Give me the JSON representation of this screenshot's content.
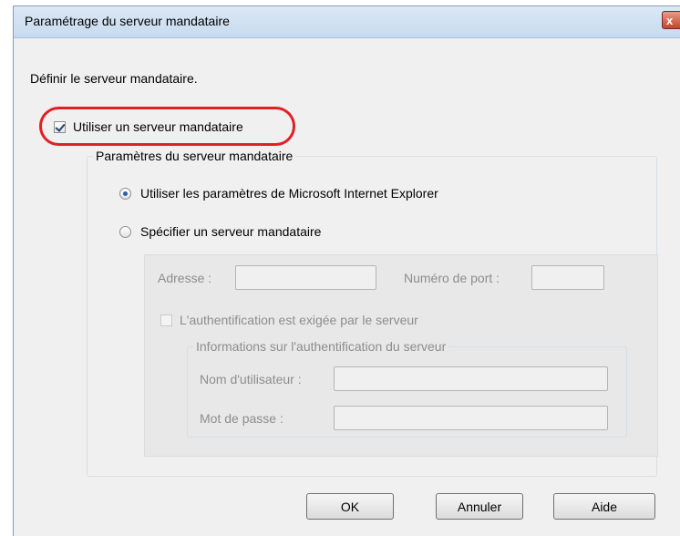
{
  "window": {
    "title": "Paramétrage du serveur mandataire",
    "close_glyph": "x"
  },
  "intro": "Définir le serveur mandataire.",
  "use_proxy": {
    "label": "Utiliser un serveur mandataire",
    "checked": true
  },
  "settings": {
    "legend": "Paramètres du serveur mandataire",
    "option_ie": "Utiliser les paramètres de Microsoft Internet Explorer",
    "option_specify": "Spécifier un serveur mandataire",
    "selected": "option_ie",
    "address_label": "Adresse :",
    "port_label": "Numéro de port :",
    "auth_required_label": "L'authentification est exigée par le serveur",
    "auth": {
      "legend": "Informations sur l'authentification du serveur",
      "username_label": "Nom d'utilisateur :",
      "password_label": "Mot de passe :"
    }
  },
  "buttons": {
    "ok": "OK",
    "cancel": "Annuler",
    "help": "Aide"
  },
  "colors": {
    "highlight": "#e31f26",
    "window_bg": "#f0f0f0"
  },
  "icons": {
    "close": "close-icon",
    "checkbox": "checkmark-icon",
    "radio": "radio-dot-icon"
  }
}
